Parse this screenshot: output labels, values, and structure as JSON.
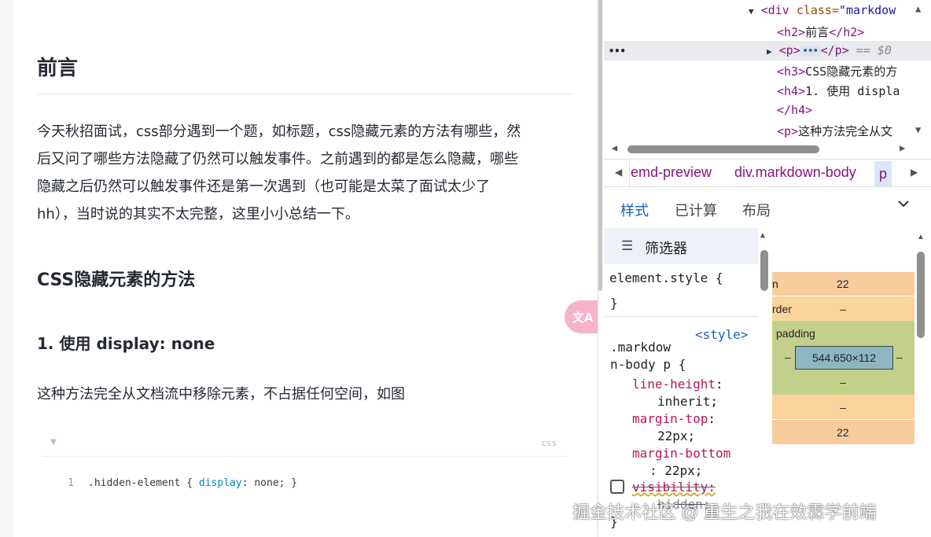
{
  "article": {
    "heading": "前言",
    "paragraph_lines": [
      "今天秋招面试，css部分遇到一个题，如标题，css隐藏元素的方法有哪些，然",
      "后又问了哪些方法隐藏了仍然可以触发事件。之前遇到的都是怎么隐藏，哪些",
      "隐藏之后仍然可以触发事件还是第一次遇到（也可能是太菜了面试太少了",
      "hh），当时说的其实不太完整，这里小小总结一下。"
    ],
    "section_title": "CSS隐藏元素的方法",
    "subsection_title": "1. 使用 display: none",
    "paragraph2": "这种方法完全从文档流中移除元素，不占据任何空间，如图",
    "code": {
      "language": "css",
      "line_number": "1",
      "selector": ".hidden-element { ",
      "property": "display",
      "rest": ": none; }"
    },
    "translate_badge": "文A"
  },
  "devtools": {
    "dom": {
      "line1_tag_open": "<div ",
      "line1_attr": "class=",
      "line1_val": "\"markdow",
      "line2": [
        "<h2>",
        "前言",
        "</h2>"
      ],
      "line3_open": "<p>",
      "line3_ellipsis": "•••",
      "line3_close": "</p>",
      "line3_eq": " == $0",
      "line4": [
        "<h3>",
        "CSS隐藏元素的方"
      ],
      "line5": [
        "<h4>",
        "1. 使用 displa"
      ],
      "line6": "</h4>",
      "line7": [
        "<p>",
        "这种方法完全从文"
      ],
      "row_dots": "•••"
    },
    "breadcrumb": [
      "emd-preview",
      "div.markdown-body",
      "p"
    ],
    "tabs": [
      "样式",
      "已计算",
      "布局"
    ],
    "filter_label": "筛选器",
    "styles": {
      "element_style": "element.style {",
      "close_brace": "}",
      "source": "<style>",
      "selector_line1": ".markdow",
      "selector_line2": "n-body p {",
      "decls": [
        {
          "prop": "line-height",
          "value": "inherit;"
        },
        {
          "prop": "margin-top",
          "value": "22px;"
        },
        {
          "prop": "margin-bottom",
          "value": "22px;"
        }
      ],
      "disabled_prop": "visibility:",
      "disabled_value": "hidden;"
    },
    "box_model": {
      "margin_label": "n",
      "margin_top": "22",
      "border_label": "rder",
      "border_value": "–",
      "padding_label": "padding",
      "padding_side": "–",
      "content": "544.650×112",
      "padding_bottom": "–",
      "border_bottom": "–",
      "margin_bottom": "22"
    }
  },
  "watermark": "掘金技术社区 @ 重生之我在效霖学前端"
}
